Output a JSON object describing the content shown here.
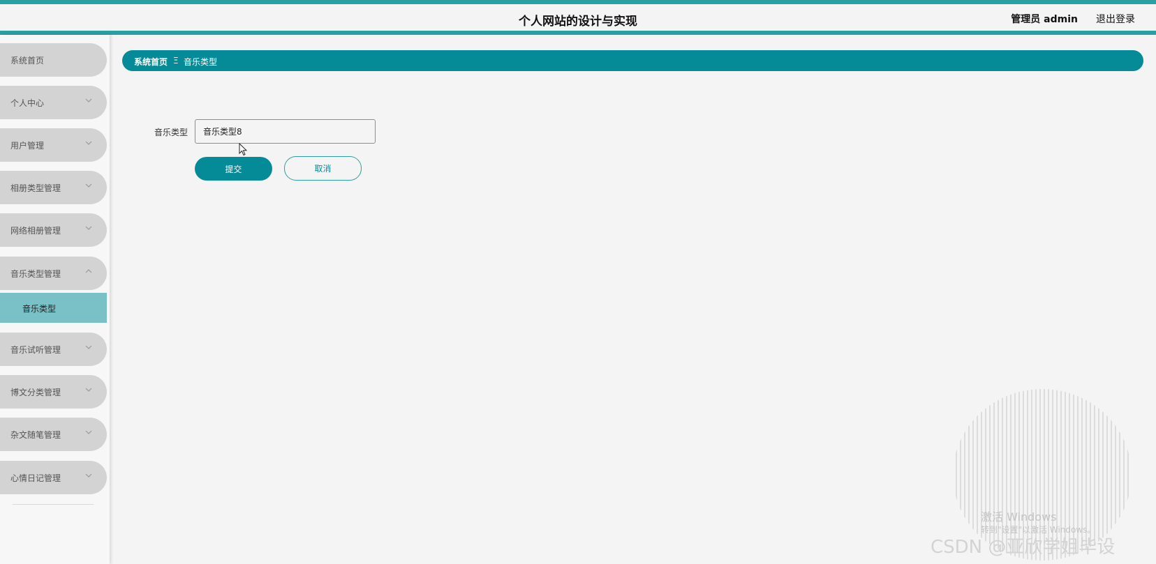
{
  "header": {
    "title": "个人网站的设计与实现",
    "user": "管理员 admin",
    "logout": "退出登录",
    "accent_color": "#2a9fa3"
  },
  "sidebar": {
    "items": [
      {
        "label": "系统首页"
      },
      {
        "label": "个人中心",
        "icon": "chevron-down-icon"
      },
      {
        "label": "用户管理",
        "icon": "chevron-down-icon"
      },
      {
        "label": "相册类型管理",
        "icon": "chevron-down-icon"
      },
      {
        "label": "网络相册管理",
        "icon": "chevron-down-icon"
      },
      {
        "label": "音乐类型管理",
        "icon": "chevron-up-icon",
        "expanded": true
      },
      {
        "label": "音乐试听管理",
        "icon": "chevron-down-icon"
      },
      {
        "label": "博文分类管理",
        "icon": "chevron-down-icon"
      },
      {
        "label": "杂文随笔管理",
        "icon": "chevron-down-icon"
      },
      {
        "label": "心情日记管理",
        "icon": "chevron-down-icon"
      }
    ],
    "sub_item": {
      "label": "音乐类型",
      "active": true
    }
  },
  "breadcrumb": {
    "home": "系统首页",
    "separator": "Ξ",
    "current": "音乐类型",
    "color": "#058b97"
  },
  "form": {
    "field_label": "音乐类型",
    "field_value": "音乐类型8",
    "submit_label": "提交",
    "cancel_label": "取消"
  },
  "watermark": {
    "activate_title": "激活 Windows",
    "activate_sub": "转到\"设置\"以激活 Windows。",
    "csdn": "CSDN @亚欣学姐毕设"
  }
}
